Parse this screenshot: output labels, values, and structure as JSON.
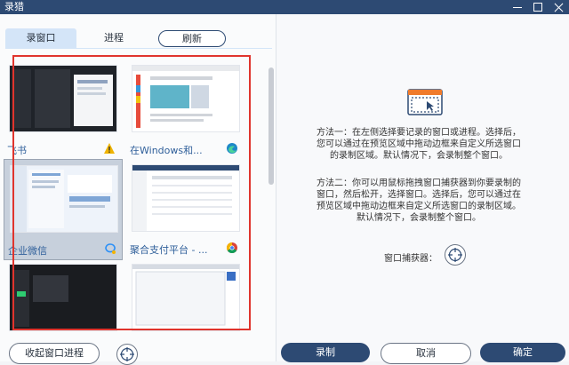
{
  "app": {
    "title": "录猎"
  },
  "tabs": [
    {
      "label": "录窗口",
      "active": true
    },
    {
      "label": "进程",
      "active": false
    }
  ],
  "refresh_label": "刷新",
  "items": [
    {
      "name": "飞书",
      "badge": "warning-icon",
      "selected": false
    },
    {
      "name": "在Windows和...",
      "badge": "edge-icon",
      "selected": false
    },
    {
      "name": "企业微信",
      "badge": "wecom-icon",
      "selected": true
    },
    {
      "name": "聚合支付平台 - ...",
      "badge": "chrome-icon",
      "selected": false
    },
    {
      "name": "",
      "badge": "",
      "selected": false
    },
    {
      "name": "",
      "badge": "",
      "selected": false
    }
  ],
  "instructions": {
    "method1": "方法一：在左侧选择要记录的窗口或进程。选择后，您可以通过在预览区域中拖动边框来自定义所选窗口的录制区域。默认情况下，会录制整个窗口。",
    "method2": "方法二：你可以用鼠标拖拽窗口捕获器到你要录制的窗口，然后松开，选择窗口。选择后，您可以通过在预览区域中拖动边框来自定义所选窗口的录制区域。默认情况下，会录制整个窗口。",
    "capture_label": "窗口捕获器："
  },
  "buttons": {
    "collapse": "收起窗口进程",
    "record": "录制",
    "cancel": "取消",
    "ok": "确定"
  },
  "colors": {
    "accent": "#2d4a73",
    "highlight": "#e0342d",
    "tab_active": "#d4e5f8"
  }
}
